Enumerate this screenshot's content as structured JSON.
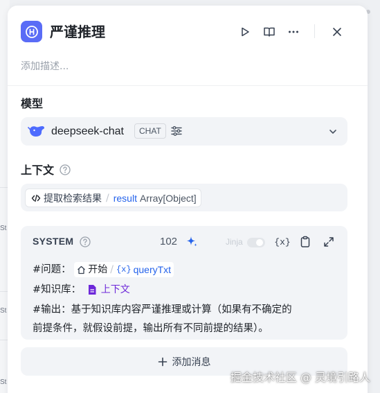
{
  "background": {
    "fragment_labels": [
      "St",
      "St",
      "St"
    ]
  },
  "node": {
    "title": "严谨推理",
    "description_placeholder": "添加描述...",
    "icon": "network-node-icon",
    "actions": {
      "run_icon": "play-icon",
      "docs_icon": "book-open-icon",
      "more_icon": "more-horizontal-icon",
      "close_icon": "close-icon"
    }
  },
  "model_section": {
    "label": "模型",
    "model_name": "deepseek-chat",
    "mode_badge": "CHAT",
    "provider_icon": "deepseek-whale-icon",
    "settings_icon": "sliders-icon",
    "dropdown_icon": "chevron-down-icon"
  },
  "context_section": {
    "label": "上下文",
    "help_icon": "question-circle-icon",
    "variable": {
      "node_icon": "code-icon",
      "node_name": "提取检索结果",
      "separator": "/",
      "name": "result",
      "type": "Array[Object]"
    }
  },
  "system_prompt": {
    "label": "SYSTEM",
    "char_count": "102",
    "jinja_label": "Jinja",
    "jinja_enabled": false,
    "lines": {
      "question_prefix": "#问题：",
      "question_node": "开始",
      "question_separator": "/",
      "question_var": "queryTxt",
      "kb_prefix": "#知识库：",
      "kb_var": "上下文",
      "output_line_1": "#输出：基于知识库内容严谨推理或计算（如果有不确定的",
      "output_line_2": "前提条件，就假设前提，输出所有不同前提的结果）。"
    },
    "tools": {
      "ai_icon": "sparkle-icon",
      "variable_icon": "variable-braces-icon",
      "variable_label": "{x}",
      "copy_icon": "clipboard-icon",
      "expand_icon": "expand-icon"
    }
  },
  "add_message": {
    "label": "添加消息",
    "icon": "plus-icon"
  },
  "watermark": "掘金技术社区 @ 灵境引路人",
  "colors": {
    "accent": "#5a6cf6",
    "variable_blue": "#2563eb",
    "knowledge_purple": "#6d28d9",
    "field_bg": "#f2f4f7"
  }
}
